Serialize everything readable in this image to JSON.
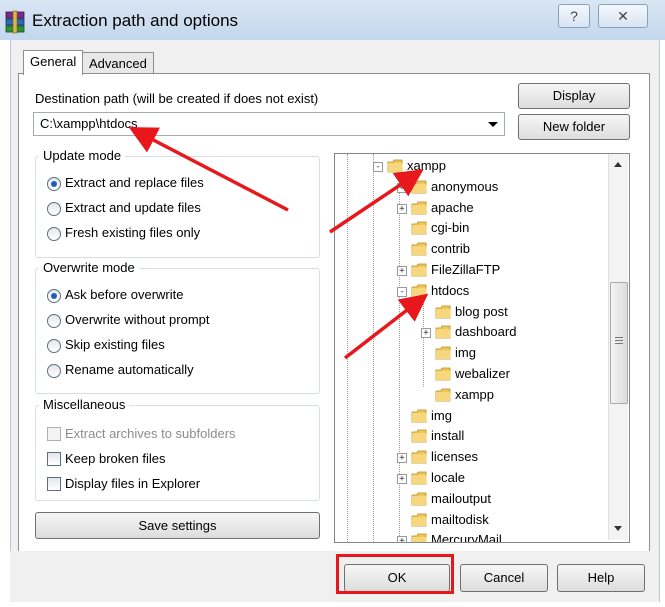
{
  "window": {
    "title": "Extraction path and options",
    "help_label": "?",
    "close_label": "✕"
  },
  "tabs": [
    {
      "label": "General",
      "active": true
    },
    {
      "label": "Advanced",
      "active": false
    }
  ],
  "destination": {
    "label": "Destination path (will be created if does not exist)",
    "value": "C:\\xampp\\htdocs",
    "display_button": "Display",
    "new_folder_button": "New folder"
  },
  "update_mode": {
    "title": "Update mode",
    "options": [
      {
        "label": "Extract and replace files",
        "selected": true
      },
      {
        "label": "Extract and update files",
        "selected": false
      },
      {
        "label": "Fresh existing files only",
        "selected": false
      }
    ]
  },
  "overwrite_mode": {
    "title": "Overwrite mode",
    "options": [
      {
        "label": "Ask before overwrite",
        "selected": true
      },
      {
        "label": "Overwrite without prompt",
        "selected": false
      },
      {
        "label": "Skip existing files",
        "selected": false
      },
      {
        "label": "Rename automatically",
        "selected": false
      }
    ]
  },
  "misc": {
    "title": "Miscellaneous",
    "options": [
      {
        "label": "Extract archives to subfolders",
        "checked": false,
        "disabled": true
      },
      {
        "label": "Keep broken files",
        "checked": false,
        "disabled": false
      },
      {
        "label": "Display files in Explorer",
        "checked": false,
        "disabled": false
      }
    ]
  },
  "save_settings_button": "Save settings",
  "tree": [
    {
      "label": "xampp",
      "expander": "minus"
    },
    {
      "label": "anonymous",
      "expander": "plus"
    },
    {
      "label": "apache",
      "expander": "plus"
    },
    {
      "label": "cgi-bin",
      "expander": "none"
    },
    {
      "label": "contrib",
      "expander": "none"
    },
    {
      "label": "FileZillaFTP",
      "expander": "plus"
    },
    {
      "label": "htdocs",
      "expander": "minus"
    },
    {
      "label": "blog post",
      "expander": "none"
    },
    {
      "label": "dashboard",
      "expander": "plus"
    },
    {
      "label": "img",
      "expander": "none"
    },
    {
      "label": "webalizer",
      "expander": "none"
    },
    {
      "label": "xampp",
      "expander": "none"
    },
    {
      "label": "img",
      "expander": "none"
    },
    {
      "label": "install",
      "expander": "none"
    },
    {
      "label": "licenses",
      "expander": "plus"
    },
    {
      "label": "locale",
      "expander": "plus"
    },
    {
      "label": "mailoutput",
      "expander": "none"
    },
    {
      "label": "mailtodisk",
      "expander": "none"
    },
    {
      "label": "MercuryMail",
      "expander": "plus"
    }
  ],
  "footer": {
    "ok": "OK",
    "cancel": "Cancel",
    "help": "Help"
  },
  "colors": {
    "annotation_red": "#e8171c",
    "radio_dot": "#1e5fb4",
    "folder_yellow": "#f0c75a"
  }
}
